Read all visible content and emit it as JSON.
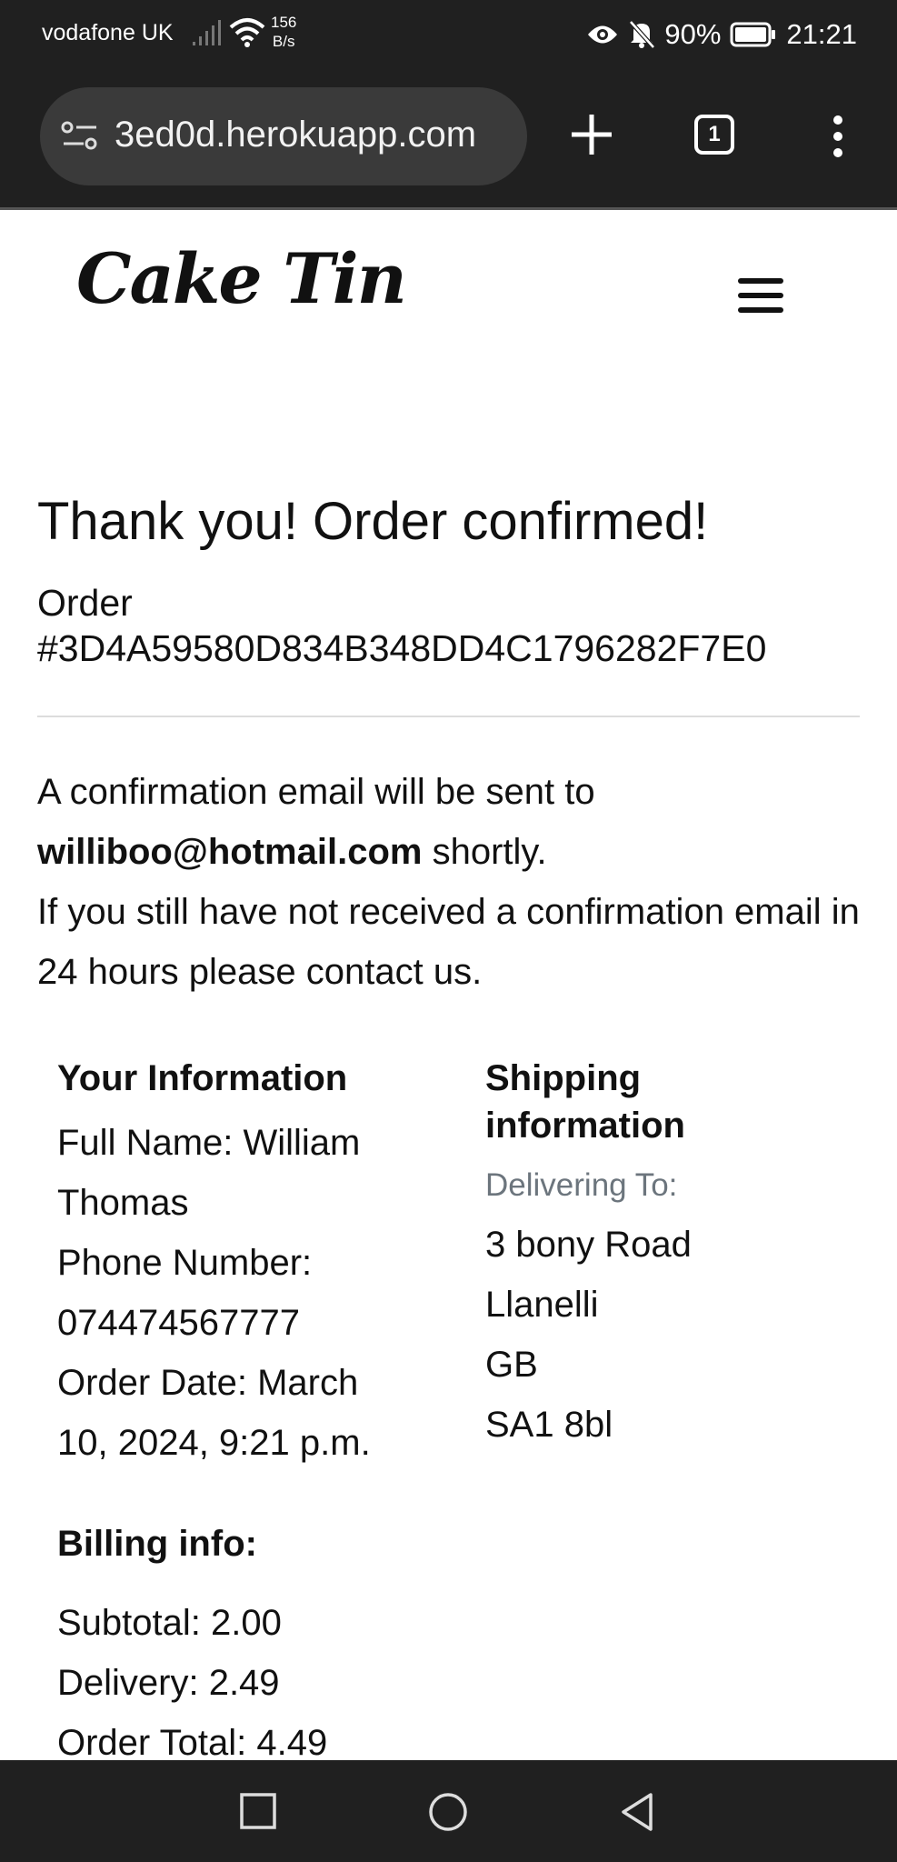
{
  "status_bar": {
    "carrier": "vodafone UK",
    "net_speed_value": "156",
    "net_speed_unit": "B/s",
    "battery": "90%",
    "time": "21:21"
  },
  "browser": {
    "url": "3ed0d.herokuapp.com",
    "tab_count": "1"
  },
  "site": {
    "logo": "Cake Tin"
  },
  "order": {
    "title": "Thank you! Order confirmed!",
    "order_label": "Order",
    "order_number": "#3D4A59580D834B348DD4C1796282F7E0",
    "confirm_prefix": "A confirmation email will be sent to",
    "email": "williboo@hotmail.com",
    "confirm_suffix": "shortly.",
    "contact_note": "If you still have not received a confirmation email in 24 hours please contact us."
  },
  "your_info": {
    "heading": "Your Information",
    "full_name_1": "Full Name: William",
    "full_name_2": "Thomas",
    "phone_1": "Phone Number:",
    "phone_2": "074474567777",
    "date_1": "Order Date: March",
    "date_2": "10, 2024, 9:21 p.m."
  },
  "shipping": {
    "heading_1": "Shipping",
    "heading_2": "information",
    "delivering_label": "Delivering To:",
    "address_line1": "3 bony Road",
    "city": "Llanelli",
    "country": "GB",
    "postcode": "SA1 8bl"
  },
  "billing": {
    "heading": "Billing info:",
    "subtotal": "Subtotal: 2.00",
    "delivery": "Delivery: 2.49",
    "total": "Order Total: 4.49"
  },
  "icons": {
    "signal": "signal-icon",
    "wifi": "wifi-icon",
    "eye": "eye-icon",
    "mute": "bell-off-icon",
    "battery": "battery-icon",
    "site_info": "site-settings-icon",
    "new_tab": "plus-icon",
    "menu": "more-vert-icon",
    "hamburger": "hamburger-icon",
    "recents": "square-icon",
    "home": "circle-icon",
    "back": "triangle-back-icon"
  }
}
